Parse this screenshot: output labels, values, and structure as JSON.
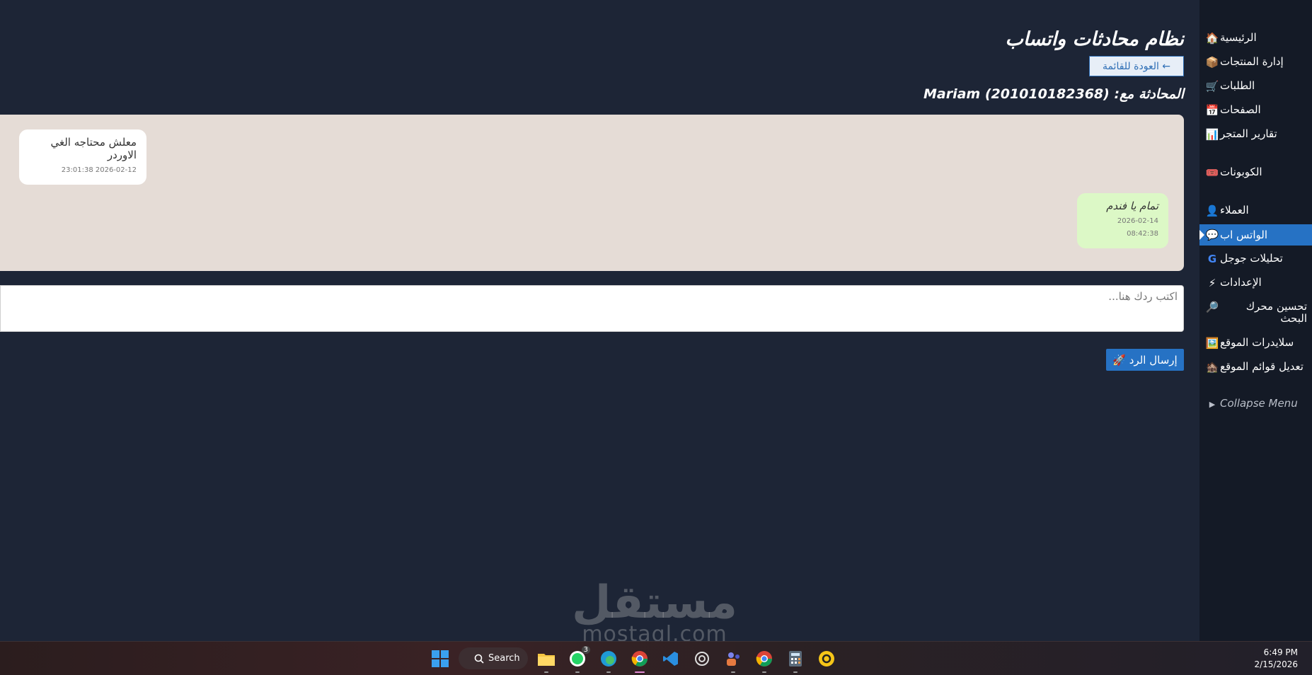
{
  "sidebar": {
    "items": [
      {
        "label": "الرئيسية",
        "icon": "🏠",
        "icon_name": "home-icon"
      },
      {
        "label": "إدارة المنتجات",
        "icon": "📦",
        "icon_name": "products-icon"
      },
      {
        "label": "الطلبات",
        "icon": "🛒",
        "icon_name": "cart-icon"
      },
      {
        "label": "الصفحات",
        "icon": "📅",
        "icon_name": "pages-icon"
      },
      {
        "label": "تقارير المتجر",
        "icon": "📊",
        "icon_name": "reports-icon"
      },
      {
        "label": "الكوبونات",
        "icon": "🎟️",
        "icon_name": "coupons-icon"
      },
      {
        "label": "العملاء",
        "icon": "👤",
        "icon_name": "customers-icon"
      },
      {
        "label": "الواتس اب",
        "icon": "💬",
        "icon_name": "whatsapp-icon"
      },
      {
        "label": "تحليلات جوجل",
        "icon": "G",
        "icon_name": "google-icon"
      },
      {
        "label": "الإعدادات",
        "icon": "⚡",
        "icon_name": "settings-icon"
      },
      {
        "label": "تحسين محرك البحث",
        "icon": "🔎",
        "icon_name": "seo-icon"
      },
      {
        "label": "سلايدرات الموقع",
        "icon": "🖼️",
        "icon_name": "sliders-icon"
      },
      {
        "label": "تعديل قوائم الموقع",
        "icon": "🏚️",
        "icon_name": "menus-icon"
      },
      {
        "label": "Collapse Menu",
        "icon": "▶",
        "icon_name": "collapse-icon"
      }
    ]
  },
  "main": {
    "title": "نظام محادثات واتساب",
    "back_label": "← العودة للقائمة",
    "conversation_title": "المحادثة مع: Mariam (201010182368)",
    "messages": [
      {
        "direction": "in",
        "text": "معلش محتاجه الغي الاوردر",
        "time": "2026-02-12 23:01:38"
      },
      {
        "direction": "out",
        "text": "تمام يا فندم",
        "time": "2026-02-14 08:42:38"
      }
    ],
    "reply_placeholder": "اكتب ردك هنا...",
    "send_label": "إرسال الرد 🚀"
  },
  "watermark": {
    "ar": "مستقل",
    "en": "mostaql.com"
  },
  "taskbar": {
    "search_label": "Search",
    "whatsapp_badge": "3",
    "time": "6:49 PM",
    "date": "2/15/2026"
  },
  "colors": {
    "background": "#1d2536",
    "sidebar": "#141a26",
    "accent": "#2672c4",
    "chat_bg": "#e5dcd6",
    "outgoing_bubble": "#dcf8c6"
  }
}
